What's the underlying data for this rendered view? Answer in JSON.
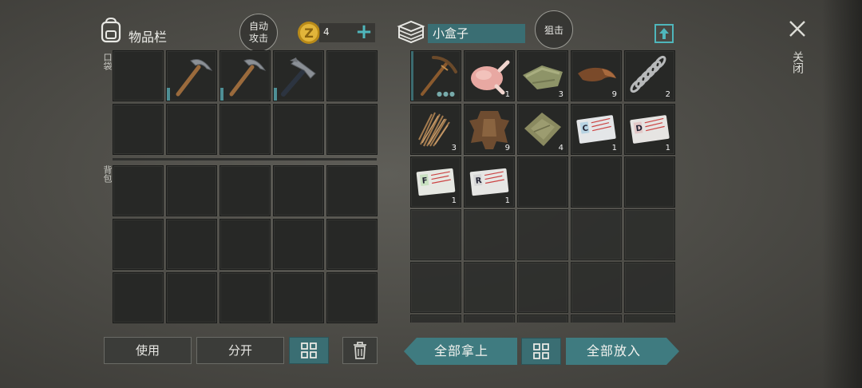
{
  "inventory": {
    "title": "物品栏",
    "auto_attack": "自动\n攻击",
    "coins": "4",
    "pocket_label": "口袋",
    "backpack_label": "背包"
  },
  "container": {
    "name": "小盒子",
    "snipe": "狙击"
  },
  "close_label": "关闭",
  "actions": {
    "use": "使用",
    "split": "分开",
    "take_all": "全部拿上",
    "put_all": "全部放入"
  },
  "pocket_items": [
    {
      "icon": "pickaxe-icon",
      "count": ""
    },
    {
      "icon": "pickaxe-icon",
      "count": ""
    },
    {
      "icon": "hammer-icon",
      "count": ""
    }
  ],
  "container_items": [
    {
      "icon": "wooden-pickaxe-icon",
      "count": ""
    },
    {
      "icon": "raw-chicken-icon",
      "count": "1"
    },
    {
      "icon": "cloth-icon",
      "count": "3"
    },
    {
      "icon": "leather-icon",
      "count": "9"
    },
    {
      "icon": "spring-icon",
      "count": "2"
    },
    {
      "icon": "fiber-icon",
      "count": "3"
    },
    {
      "icon": "animal-hide-icon",
      "count": "9"
    },
    {
      "icon": "rag-icon",
      "count": "4"
    },
    {
      "icon": "id-card-c-icon",
      "count": "1"
    },
    {
      "icon": "id-card-d-icon",
      "count": "1"
    },
    {
      "icon": "id-card-f-icon",
      "count": "1"
    },
    {
      "icon": "id-card-r-icon",
      "count": "1"
    }
  ],
  "colors": {
    "accent_teal": "#3a6e73",
    "slot_bg": "#272826",
    "coin_gold": "#d9a828"
  }
}
